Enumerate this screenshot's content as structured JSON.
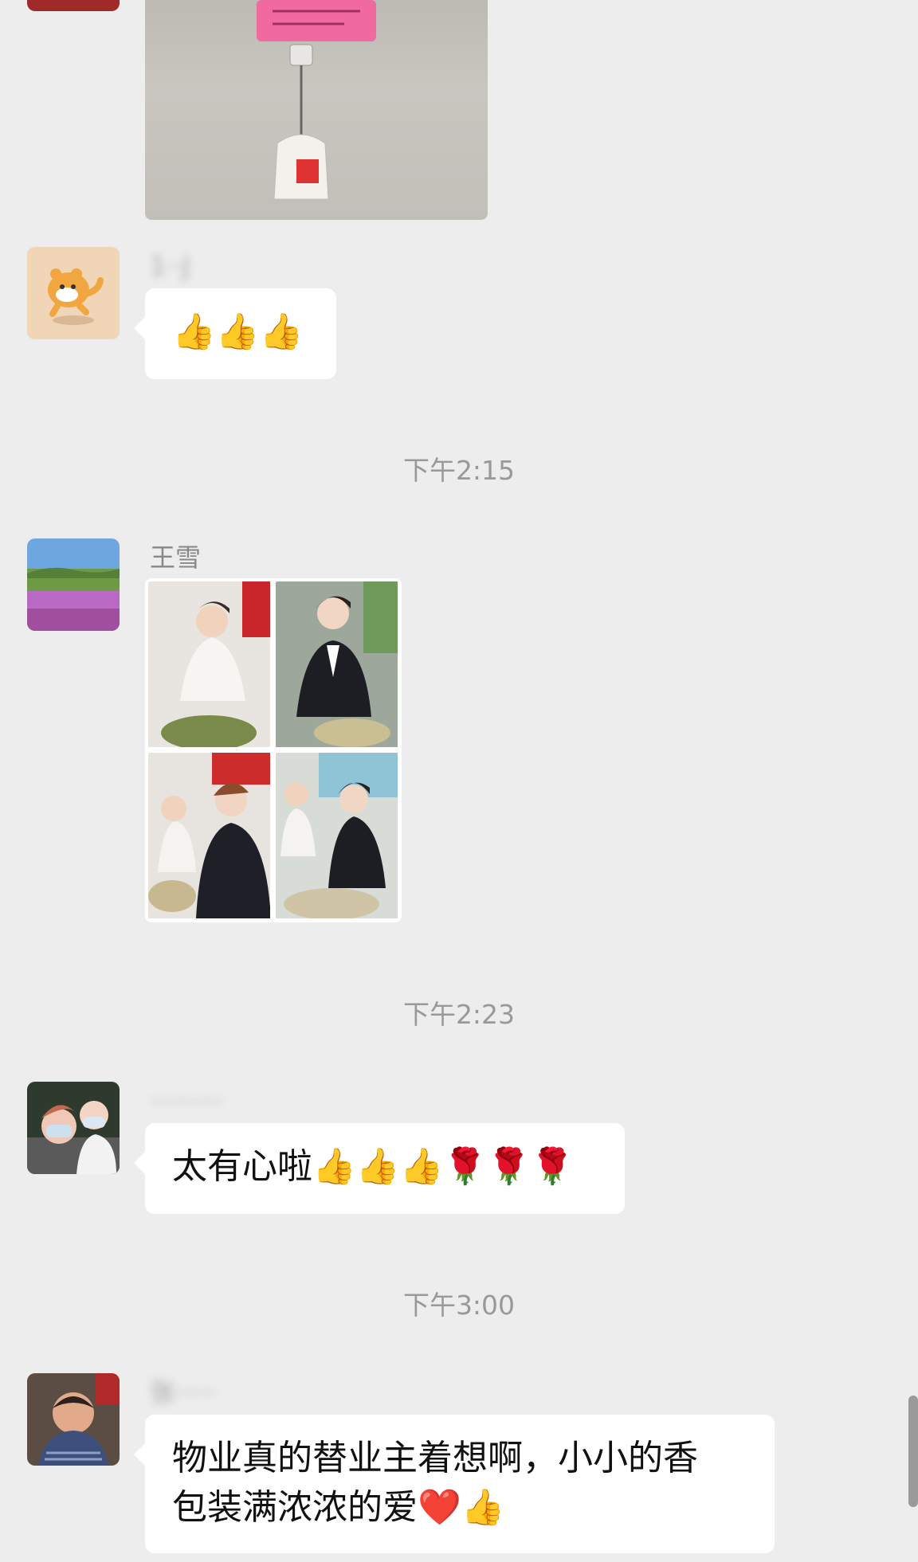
{
  "messages": {
    "m1": {
      "sender": "1··J",
      "text": "👍👍👍"
    },
    "m2": {
      "sender": "王雪",
      "collage_alt": [
        "photo-1",
        "photo-2",
        "photo-3",
        "photo-4"
      ]
    },
    "m3": {
      "sender": "·········",
      "text": "太有心啦👍👍👍🌹🌹🌹"
    },
    "m4": {
      "sender": "张·····",
      "line1": "物业真的替业主着想啊，小小的香",
      "line2": "包装满浓浓的爱❤️👍"
    }
  },
  "timestamps": {
    "t1": "下午2:15",
    "t2": "下午2:23",
    "t3": "下午3:00"
  },
  "colors": {
    "background": "#ededed",
    "bubble": "#ffffff",
    "timestamp": "#999999"
  }
}
